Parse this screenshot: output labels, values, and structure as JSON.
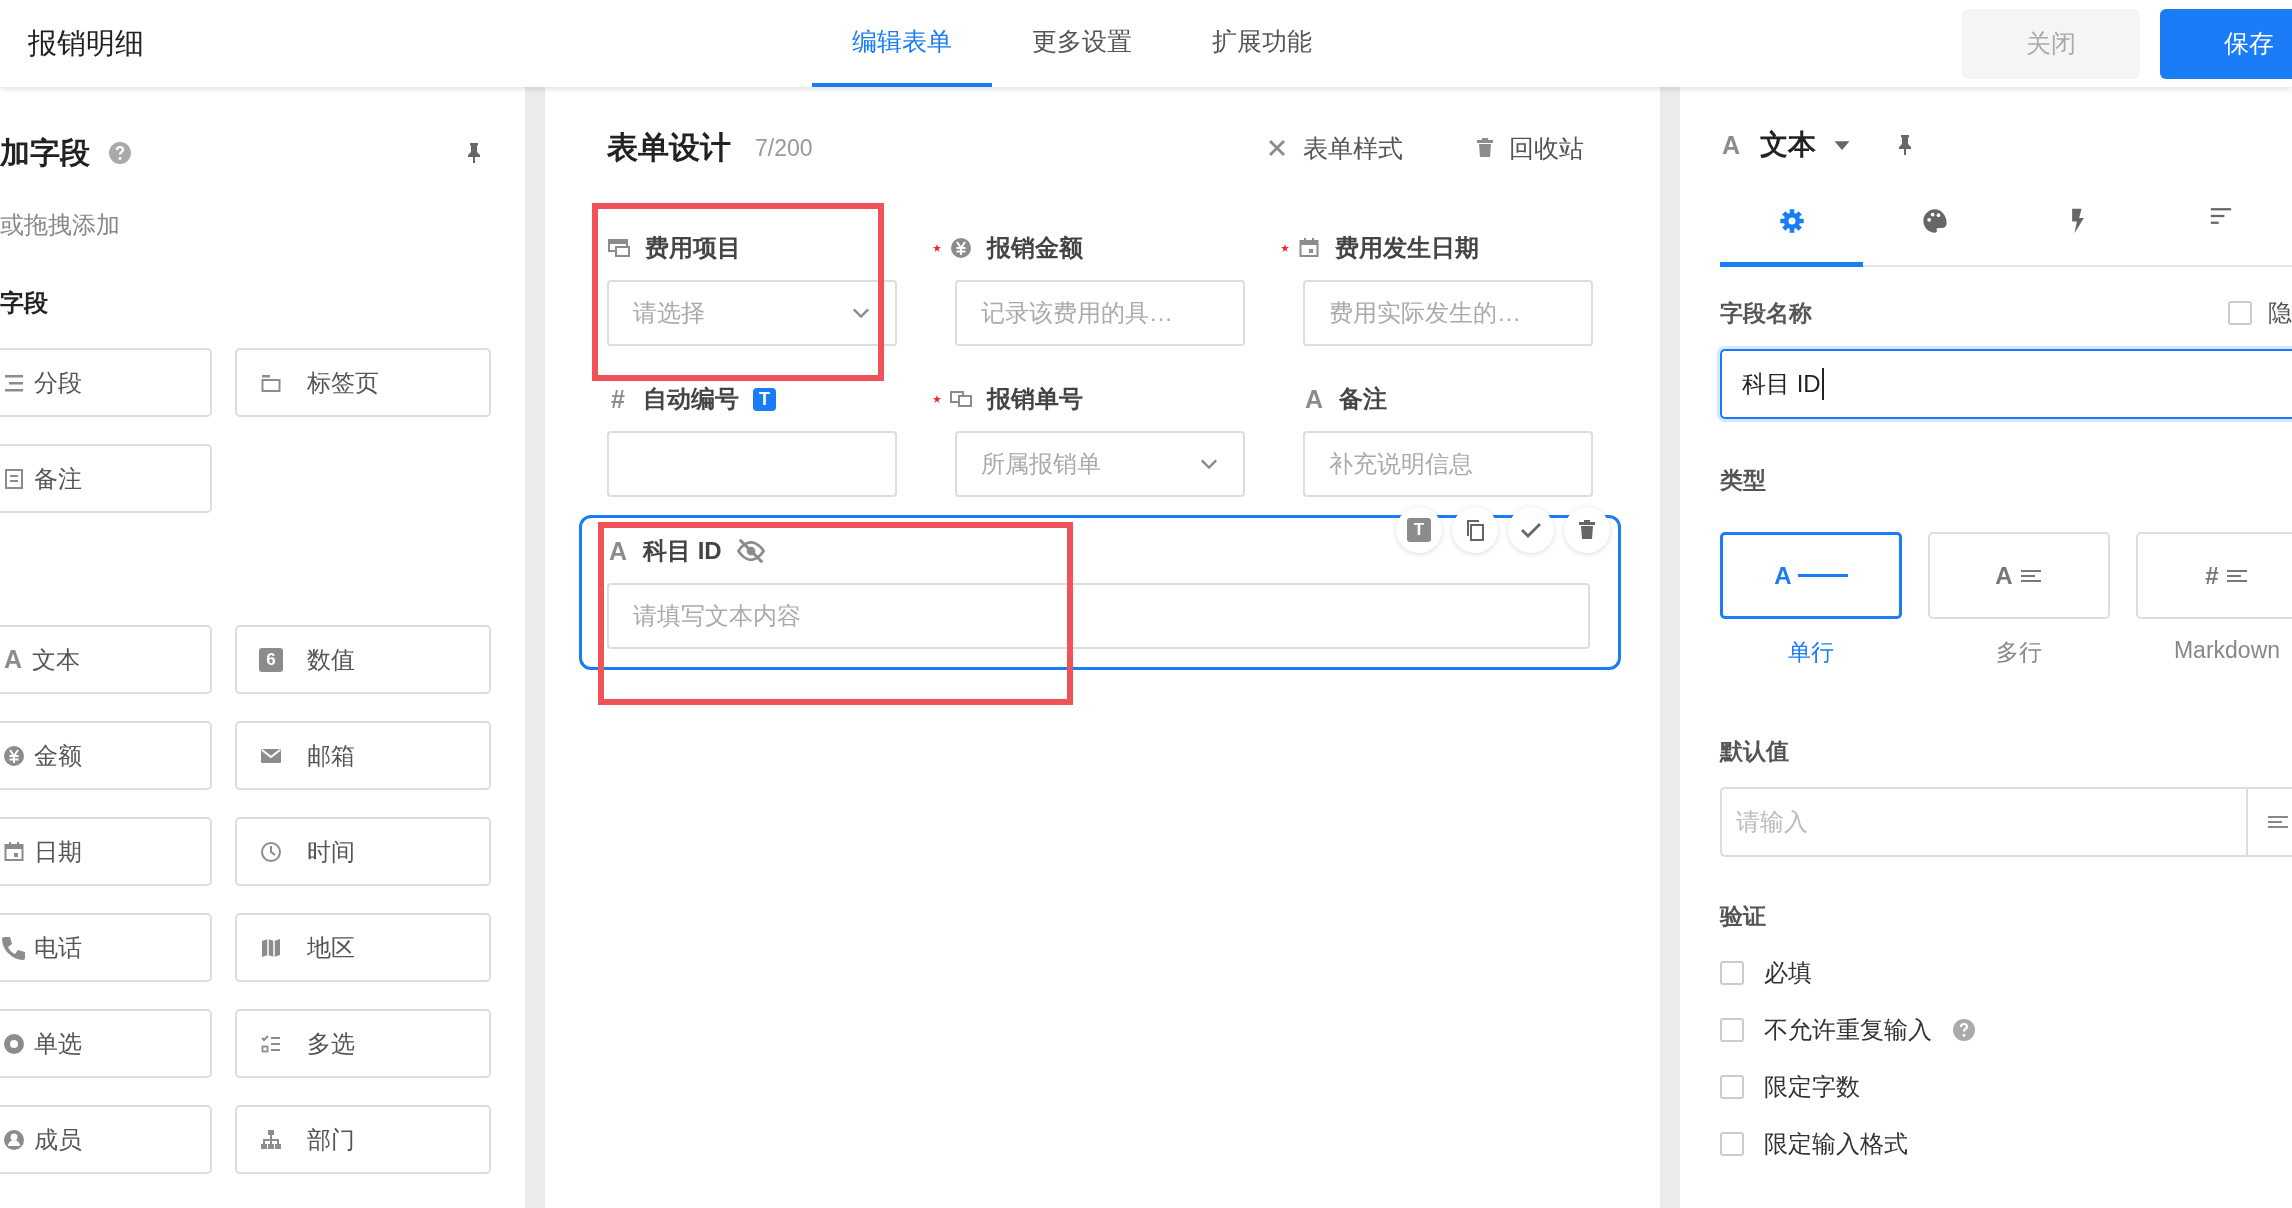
{
  "header": {
    "title": "报销明细",
    "tabs": [
      {
        "label": "编辑表单",
        "selected": true
      },
      {
        "label": "更多设置",
        "selected": false
      },
      {
        "label": "扩展功能",
        "selected": false
      }
    ],
    "buttons": [
      {
        "label": "关闭",
        "kind": "secondary"
      },
      {
        "label": "保存",
        "kind": "primary"
      }
    ]
  },
  "field_panel": {
    "title": "加字段",
    "subtitle": "或拖拽添加",
    "sections": [
      {
        "title": "字段",
        "items": [
          {
            "label": "分段",
            "kind": "section"
          },
          {
            "label": "标签页",
            "kind": "tab"
          },
          {
            "label": "备注",
            "kind": "note"
          }
        ]
      },
      {
        "items": [
          {
            "label": "文本",
            "kind": "text",
            "glyph": "A"
          },
          {
            "label": "数值",
            "kind": "number",
            "glyph": "6"
          },
          {
            "label": "金额",
            "kind": "money"
          },
          {
            "label": "邮箱",
            "kind": "email"
          },
          {
            "label": "日期",
            "kind": "date"
          },
          {
            "label": "时间",
            "kind": "time"
          },
          {
            "label": "电话",
            "kind": "phone"
          },
          {
            "label": "地区",
            "kind": "region"
          },
          {
            "label": "单选",
            "kind": "radio"
          },
          {
            "label": "多选",
            "kind": "checkbox"
          },
          {
            "label": "成员",
            "kind": "member"
          },
          {
            "label": "部门",
            "kind": "dept"
          }
        ]
      }
    ]
  },
  "form": {
    "title": "表单设计",
    "count": "7/200",
    "actions": [
      {
        "label": "表单样式",
        "kind": "style"
      },
      {
        "label": "回收站",
        "kind": "trash"
      }
    ],
    "fields": [
      {
        "label": "费用项目",
        "kind": "table",
        "required": false,
        "dropdown": true,
        "placeholder": "请选择",
        "selected": false,
        "hidden": false
      },
      {
        "label": "报销金额",
        "kind": "money",
        "required": true,
        "dropdown": false,
        "placeholder": "记录该费用的具…",
        "selected": false,
        "hidden": false
      },
      {
        "label": "费用发生日期",
        "kind": "date",
        "required": true,
        "dropdown": false,
        "placeholder": "费用实际发生的…",
        "selected": false,
        "hidden": false
      },
      {
        "label": "自动编号",
        "kind": "hash",
        "glyph": "#",
        "badge": "T",
        "required": false,
        "dropdown": false,
        "selected": false,
        "hidden": false
      },
      {
        "label": "报销单号",
        "kind": "link",
        "required": true,
        "dropdown": true,
        "placeholder": "所属报销单",
        "selected": false,
        "hidden": false
      },
      {
        "label": "备注",
        "kind": "text",
        "glyph": "A",
        "required": false,
        "dropdown": false,
        "placeholder": "补充说明信息",
        "selected": false,
        "hidden": false
      },
      {
        "label": "科目 ID",
        "kind": "text",
        "glyph": "A",
        "required": false,
        "dropdown": false,
        "placeholder": "请填写文本内容",
        "selected": true,
        "hidden": true,
        "tools": [
          {
            "kind": "title",
            "glyph": "T"
          },
          {
            "kind": "copy"
          },
          {
            "kind": "check"
          },
          {
            "kind": "delete"
          }
        ]
      }
    ]
  },
  "properties": {
    "glyph": "A",
    "title": "文本",
    "tabs": [
      {
        "kind": "settings",
        "selected": true
      },
      {
        "kind": "palette",
        "selected": false
      },
      {
        "kind": "bolt",
        "selected": false
      },
      {
        "kind": "sort",
        "selected": false
      }
    ],
    "name_label": "字段名称",
    "hide_label": "隐",
    "hide_checked": false,
    "name_value": "科目 ID",
    "type_label": "类型",
    "types": [
      {
        "label": "单行",
        "kind": "single",
        "glyph": "A",
        "selected": true
      },
      {
        "label": "多行",
        "kind": "multi",
        "glyph": "A",
        "selected": false
      },
      {
        "label": "Markdown",
        "kind": "markdown",
        "glyph": "#",
        "selected": false
      }
    ],
    "default_label": "默认值",
    "default_placeholder": "请输入",
    "validation_label": "验证",
    "rules": [
      {
        "label": "必填",
        "checked": false,
        "help": false
      },
      {
        "label": "不允许重复输入",
        "checked": false,
        "help": true
      },
      {
        "label": "限定字数",
        "checked": false,
        "help": false
      },
      {
        "label": "限定输入格式",
        "checked": false,
        "help": false
      }
    ]
  }
}
